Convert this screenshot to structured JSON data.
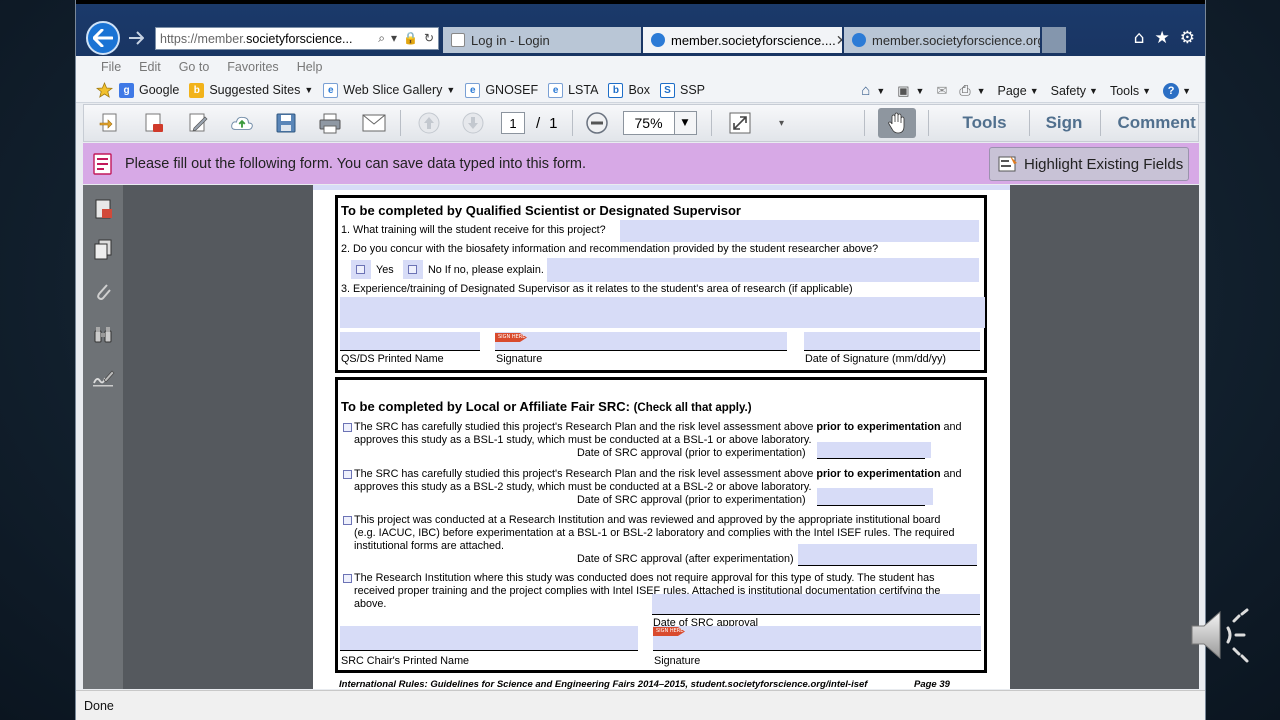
{
  "browser": {
    "address": {
      "prefix": "https://",
      "sub": "member.",
      "domain": "societyforscience..."
    },
    "tabs": [
      {
        "label": "Log in - Login"
      },
      {
        "label": "member.societyforscience...."
      },
      {
        "label": "member.societyforscience.org"
      }
    ],
    "menu": [
      "File",
      "Edit",
      "Go to",
      "Favorites",
      "Help"
    ],
    "favorites": [
      {
        "label": "Google",
        "icon": "google-icon"
      },
      {
        "label": "Suggested Sites",
        "icon": "bing-icon",
        "dropdown": true
      },
      {
        "label": "Web Slice Gallery",
        "icon": "ie-icon",
        "dropdown": true
      },
      {
        "label": "GNOSEF",
        "icon": "ie-icon"
      },
      {
        "label": "LSTA",
        "icon": "ie-icon"
      },
      {
        "label": "Box",
        "icon": "box-icon"
      },
      {
        "label": "SSP",
        "icon": "ssp-icon"
      }
    ],
    "commands": [
      "Page",
      "Safety",
      "Tools"
    ]
  },
  "acrobat": {
    "page_current": "1",
    "page_sep": "/",
    "page_total": "1",
    "zoom": "75%",
    "links": [
      "Tools",
      "Sign",
      "Comment"
    ],
    "message": "Please fill out the following form. You can save data typed into this form.",
    "highlight_button": "Highlight Existing Fields"
  },
  "form": {
    "section1": {
      "heading": "To be completed by Qualified Scientist or Designated Supervisor",
      "q1": "1.  What training will the student receive for this project?",
      "q2": "2.  Do you concur with the biosafety information and recommendation provided by the student researcher above?",
      "yes": "Yes",
      "no": "No If no, please explain.",
      "q3": "3.  Experience/training of Designated Supervisor as it relates to the student's area of research (if applicable)",
      "sign_tag": "SIGN HERE",
      "name_label": "QS/DS Printed Name",
      "signature_label": "Signature",
      "date_label": "Date of Signature (mm/dd/yy)"
    },
    "section2": {
      "heading": "To be completed by Local or Affiliate Fair SRC:",
      "heading_note": "(Check all that apply.)",
      "opt1_line1_pre": "The SRC has carefully studied this project's Research Plan and the risk level assessment above ",
      "opt1_line1_bold": "prior to experimentation",
      "opt1_line1_post": " and",
      "opt1_line2": "approves this study as a BSL-1 study, which must be conducted at a BSL-1 or above laboratory.",
      "opt1_date": "Date of SRC approval (prior to experimentation)",
      "opt2_line1_pre": "The SRC has carefully studied this project's Research Plan and the risk level assessment above ",
      "opt2_line1_bold": "prior to experimentation",
      "opt2_line1_post": " and",
      "opt2_line2": "approves this study as a BSL-2 study, which must be conducted at a BSL-2 or above laboratory.",
      "opt2_date": "Date of SRC approval (prior to experimentation)",
      "opt3_line1": "This project was conducted at a Research Institution and was reviewed and approved by the appropriate institutional board",
      "opt3_line2": "(e.g. IACUC, IBC) before experimentation at a BSL-1 or BSL-2 laboratory and complies with the Intel ISEF rules. The required",
      "opt3_line3": "institutional forms are attached.",
      "opt3_date": "Date of SRC approval (after experimentation)",
      "opt4_line1": "The Research Institution where this study was conducted does not require approval for this type of study. The student has",
      "opt4_line2": "received proper training and the project complies with Intel ISEF rules. Attached is institutional documentation certifying the",
      "opt4_line3": "above.",
      "src_date_label": "Date of SRC approval",
      "chair_label": "SRC Chair's Printed Name",
      "signature_label": "Signature"
    },
    "footer": "International Rules: Guidelines for Science and Engineering Fairs 2014–2015, student.societyforscience.org/intel-isef",
    "footer_page": "Page 39"
  },
  "status": "Done",
  "colors": {
    "accent": "#1a73d4",
    "message_bar": "#d7a9e6",
    "form_field": "#d7dcf7",
    "sign_flag": "#d94b2e"
  }
}
